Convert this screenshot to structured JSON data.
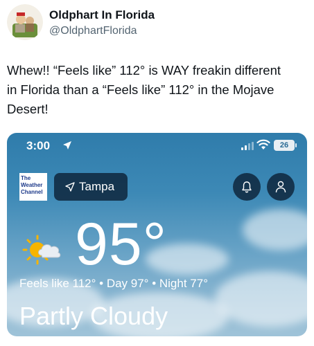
{
  "tweet": {
    "author_name": "Oldphart In Florida",
    "author_handle": "@OldphartFlorida",
    "text_line_1": "Whew!! “Feels like” 112° is WAY freakin different",
    "text_line_2": "in Florida than a “Feels like” 112° in the Mojave",
    "text_line_3": "Desert!"
  },
  "screenshot": {
    "status_bar": {
      "time": "3:00",
      "battery": "26"
    },
    "logo_lines": [
      "The",
      "Weather",
      "Channel"
    ],
    "location": "Tampa",
    "temperature": "95°",
    "feels_line": "Feels like 112° • Day 97° • Night 77°",
    "condition": "Partly Cloudy",
    "icons": [
      "location-arrow-icon",
      "signal-icon",
      "wifi-icon",
      "battery-icon",
      "navigation-icon",
      "bell-icon",
      "user-icon",
      "partly-cloudy-icon"
    ]
  }
}
